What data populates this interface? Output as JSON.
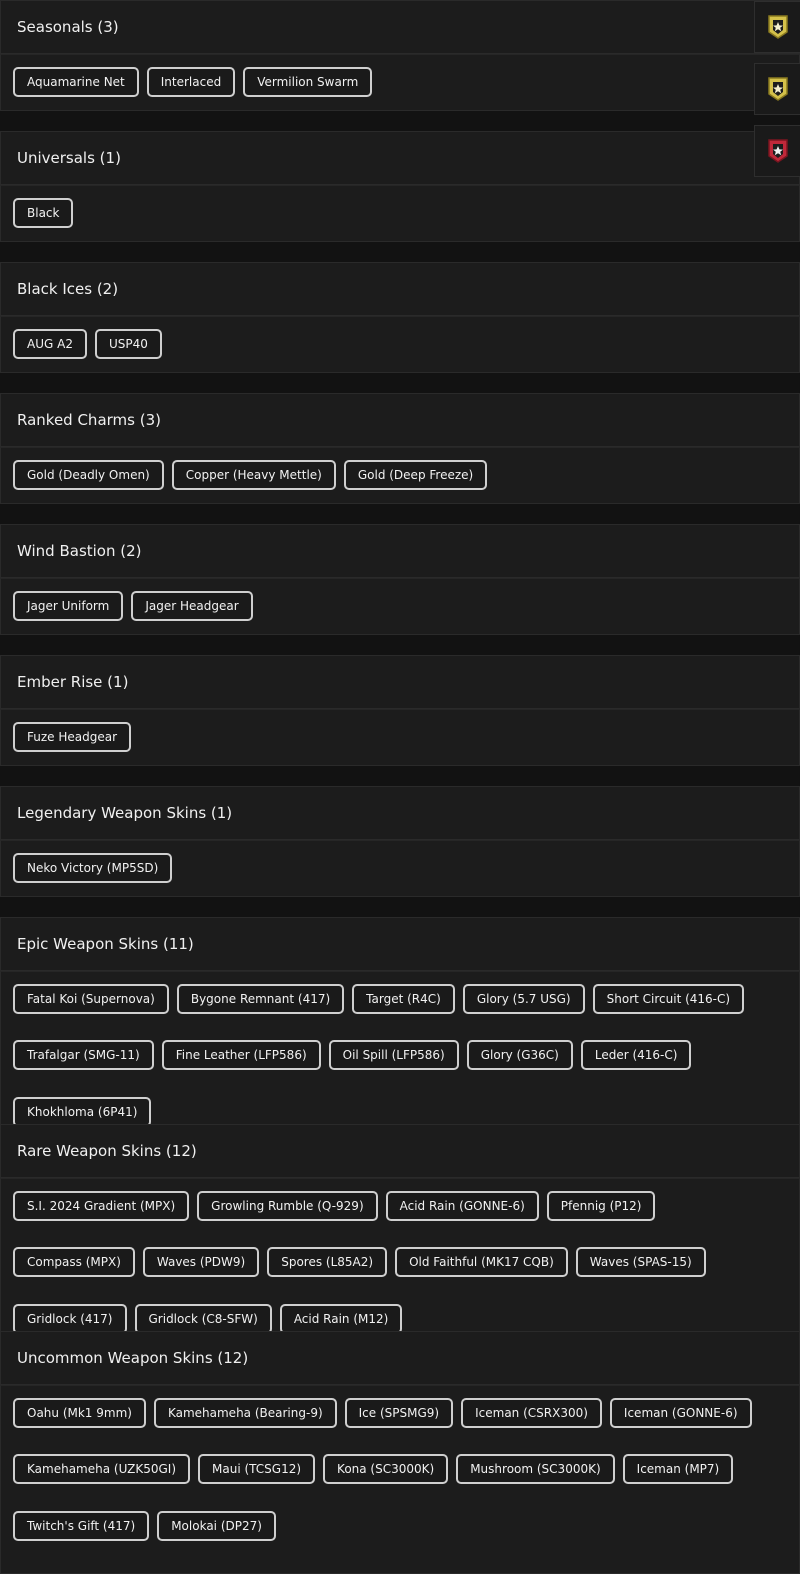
{
  "sections": [
    {
      "title": "Seasonals (3)",
      "items": [
        "Aquamarine Net",
        "Interlaced",
        "Vermilion Swarm"
      ]
    },
    {
      "title": "Universals (1)",
      "items": [
        "Black"
      ]
    },
    {
      "title": "Black Ices (2)",
      "items": [
        "AUG A2",
        "USP40"
      ]
    },
    {
      "title": "Ranked Charms (3)",
      "items": [
        "Gold (Deadly Omen)",
        "Copper (Heavy Mettle)",
        "Gold (Deep Freeze)"
      ]
    },
    {
      "title": "Wind Bastion (2)",
      "items": [
        "Jager Uniform",
        "Jager Headgear"
      ]
    },
    {
      "title": "Ember Rise (1)",
      "items": [
        "Fuze Headgear"
      ]
    },
    {
      "title": "Legendary Weapon Skins (1)",
      "items": [
        "Neko Victory (MP5SD)"
      ]
    },
    {
      "title": "Epic Weapon Skins (11)",
      "items": [
        "Fatal Koi (Supernova)",
        "Bygone Remnant (417)",
        "Target (R4C)",
        "Glory (5.7 USG)",
        "Short Circuit (416-C)",
        "Trafalgar (SMG-11)",
        "Fine Leather (LFP586)",
        "Oil Spill (LFP586)",
        "Glory (G36C)",
        "Leder (416-C)",
        "Khokhloma (6P41)"
      ]
    },
    {
      "title": "Rare Weapon Skins (12)",
      "items": [
        "S.I. 2024 Gradient (MPX)",
        "Growling Rumble (Q-929)",
        "Acid Rain (GONNE-6)",
        "Pfennig (P12)",
        "Compass (MPX)",
        "Waves (PDW9)",
        "Spores (L85A2)",
        "Old Faithful (MK17 CQB)",
        "Waves (SPAS-15)",
        "Gridlock (417)",
        "Gridlock (C8-SFW)",
        "Acid Rain (M12)"
      ]
    },
    {
      "title": "Uncommon Weapon Skins (12)",
      "items": [
        "Oahu (Mk1 9mm)",
        "Kamehameha (Bearing-9)",
        "Ice (SPSMG9)",
        "Iceman (CSRX300)",
        "Iceman (GONNE-6)",
        "Kamehameha (UZK50GI)",
        "Maui (TCSG12)",
        "Kona (SC3000K)",
        "Mushroom (SC3000K)",
        "Iceman (MP7)",
        "Twitch's Gift (417)",
        "Molokai (DP27)"
      ]
    }
  ],
  "badges": [
    {
      "icon": "gold-rank-badge-icon",
      "color": "#d4c14a"
    },
    {
      "icon": "gold-rank-badge-icon",
      "color": "#d4c14a"
    },
    {
      "icon": "red-rank-badge-icon",
      "color": "#c0283a"
    }
  ]
}
